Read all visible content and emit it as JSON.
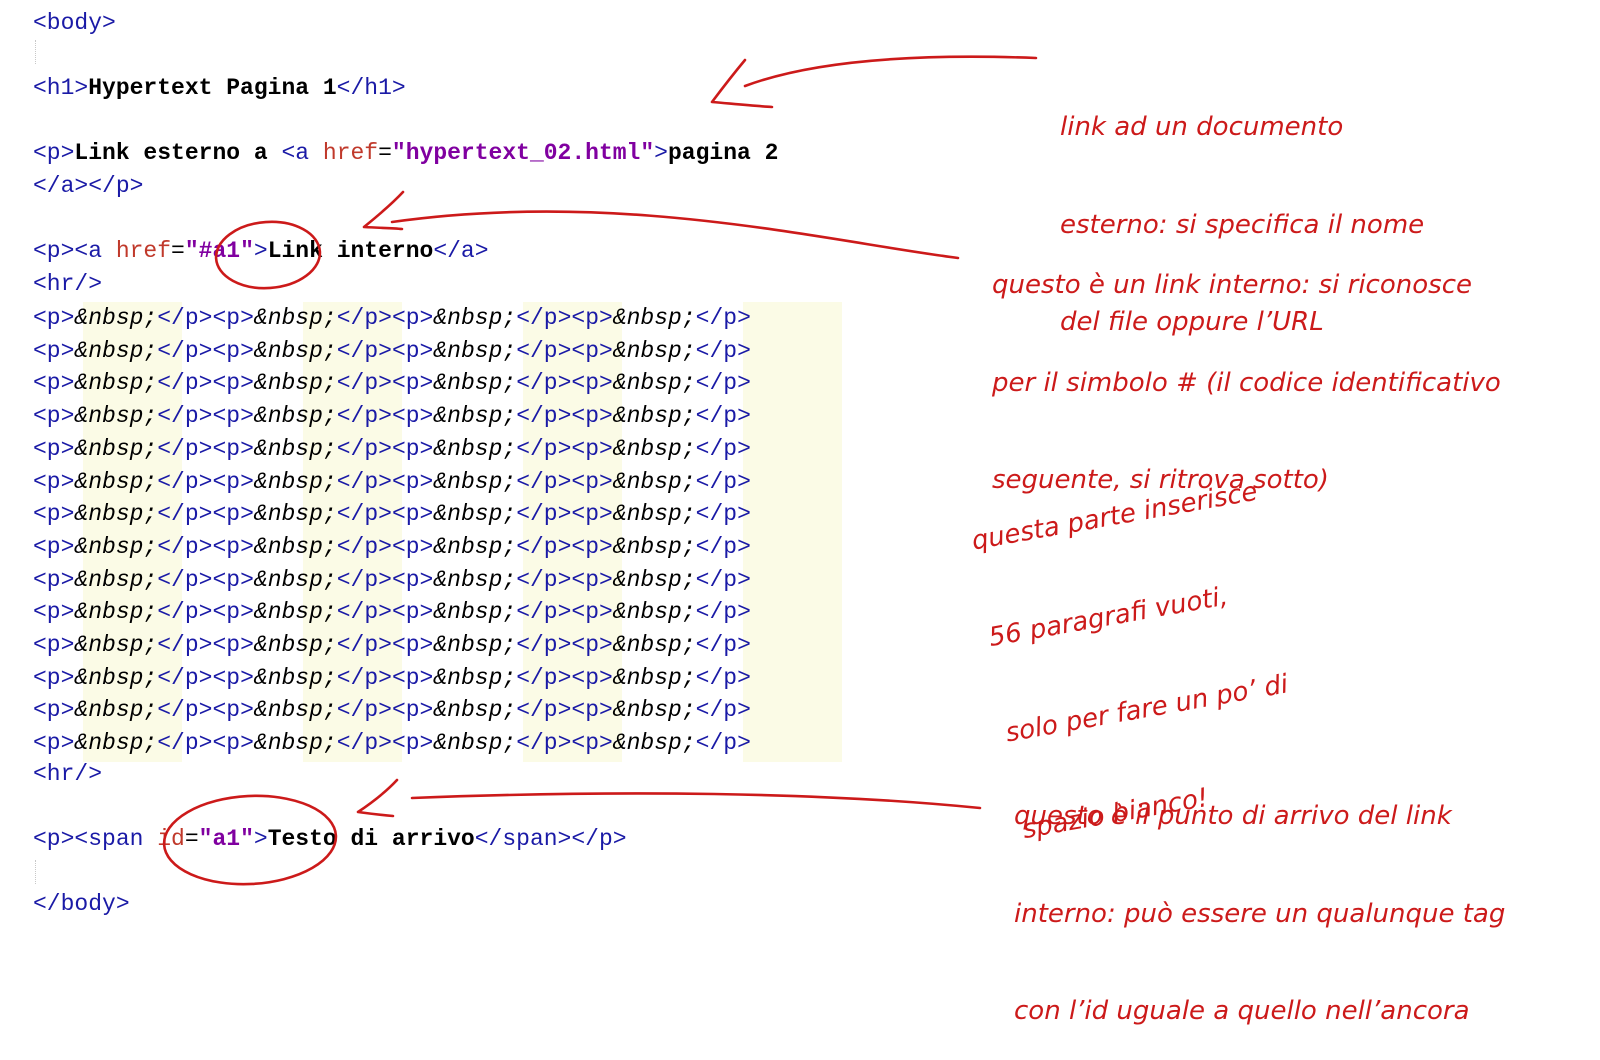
{
  "code": {
    "body_open": "<body>",
    "h1_open": "<h1>",
    "h1_text": "Hypertext Pagina 1",
    "h1_close": "</h1>",
    "p_open": "<p>",
    "p_close": "</p>",
    "link_external_text": "Link esterno a ",
    "a_open_start": "<a ",
    "href_attr": "href",
    "equals": "=",
    "href_external_value": "\"hypertext_02.html\"",
    "tag_end": ">",
    "link_external_label": "pagina 2",
    "a_close_p_close": "</a></p>",
    "p_a_open": "<p><a ",
    "href_internal_value": "\"#a1\"",
    "link_internal_label": "Link interno",
    "a_close": "</a>",
    "hr": "<hr/>",
    "nbsp_entity": "&nbsp;",
    "nbsp_row_count": 14,
    "p_span_open": "<p><span ",
    "id_attr": "id",
    "id_value": "\"a1\"",
    "arrival_text": "Testo di arrivo",
    "span_close_p_close": "</span></p>",
    "body_close": "</body>"
  },
  "annotations": {
    "external_link": [
      "link ad un documento",
      "esterno: si specifica il nome",
      "del file oppure l’URL"
    ],
    "internal_link": [
      "questo è un link interno: si riconosce",
      "per il simbolo # (il codice identificativo",
      "seguente, si ritrova sotto)"
    ],
    "empty_paragraphs": [
      "questa parte inserisce",
      "56 paragrafi vuoti,",
      "solo per fare un po’ di",
      "spazio bianco!"
    ],
    "arrival_point": [
      "questo è il punto di arrivo del link",
      "interno: può essere un qualunque tag",
      "con l’id uguale a quello nell’ancora"
    ]
  },
  "colors": {
    "tag": "#1a1aa6",
    "attribute": "#c0392b",
    "value": "#8000a0",
    "annotation_ink": "#cc1a1a",
    "entity_highlight": "#fbfbe6"
  }
}
